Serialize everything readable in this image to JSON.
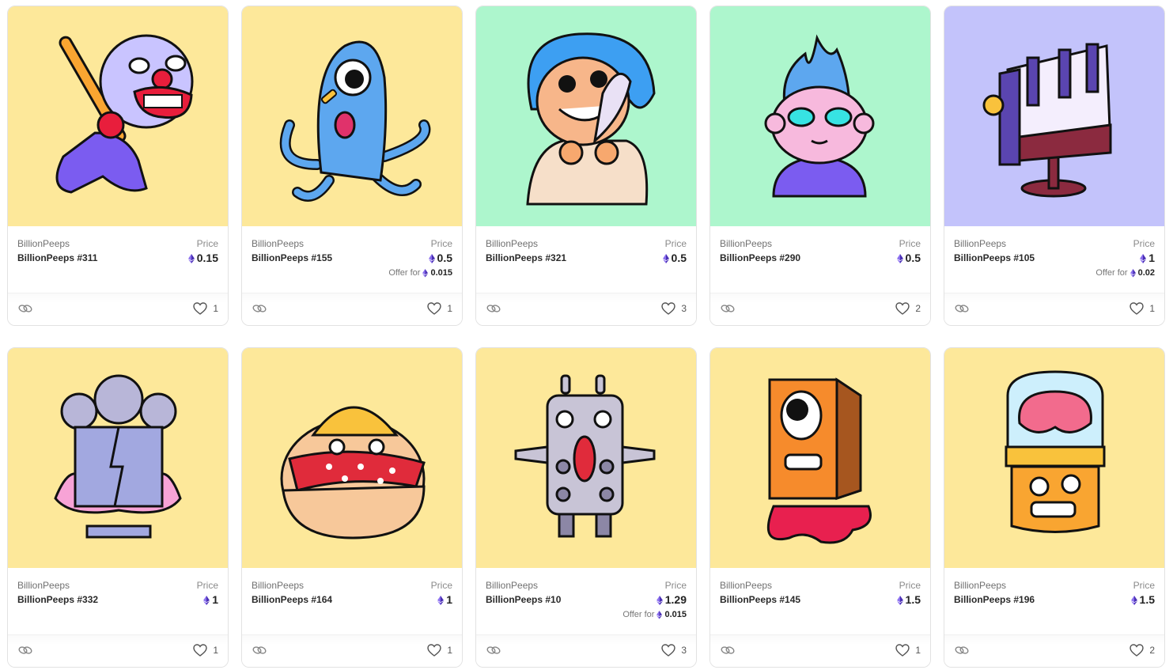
{
  "price_label": "Price",
  "offer_label": "Offer for",
  "colors": {
    "yellow": "#fde89a",
    "green": "#adf6cd",
    "lavender": "#c3c3fb",
    "eth": "#6b4fd8"
  },
  "cards": [
    {
      "collection": "BillionPeeps",
      "name": "BillionPeeps #311",
      "price": "0.15",
      "offer": "",
      "likes": "1",
      "bg": "#fde89a",
      "art": "clown-with-bat"
    },
    {
      "collection": "BillionPeeps",
      "name": "BillionPeeps #155",
      "price": "0.5",
      "offer": "0.015",
      "likes": "1",
      "bg": "#fde89a",
      "art": "blue-octopus"
    },
    {
      "collection": "BillionPeeps",
      "name": "BillionPeeps #321",
      "price": "0.5",
      "offer": "",
      "likes": "3",
      "bg": "#adf6cd",
      "art": "blue-hair-girl"
    },
    {
      "collection": "BillionPeeps",
      "name": "BillionPeeps #290",
      "price": "0.5",
      "offer": "",
      "likes": "2",
      "bg": "#adf6cd",
      "art": "flame-head-monk"
    },
    {
      "collection": "BillionPeeps",
      "name": "BillionPeeps #105",
      "price": "1",
      "offer": "0.02",
      "likes": "1",
      "bg": "#c3c3fb",
      "art": "piano-chair"
    },
    {
      "collection": "BillionPeeps",
      "name": "BillionPeeps #332",
      "price": "1",
      "offer": "",
      "likes": "1",
      "bg": "#fde89a",
      "art": "grandma-torn-box"
    },
    {
      "collection": "BillionPeeps",
      "name": "BillionPeeps #164",
      "price": "1",
      "offer": "",
      "likes": "1",
      "bg": "#fde89a",
      "art": "egg-bandana"
    },
    {
      "collection": "BillionPeeps",
      "name": "BillionPeeps #10",
      "price": "1.29",
      "offer": "0.015",
      "likes": "3",
      "bg": "#fde89a",
      "art": "robot-remote"
    },
    {
      "collection": "BillionPeeps",
      "name": "BillionPeeps #145",
      "price": "1.5",
      "offer": "",
      "likes": "1",
      "bg": "#fde89a",
      "art": "box-cyclops"
    },
    {
      "collection": "BillionPeeps",
      "name": "BillionPeeps #196",
      "price": "1.5",
      "offer": "",
      "likes": "2",
      "bg": "#fde89a",
      "art": "brain-jar"
    }
  ]
}
